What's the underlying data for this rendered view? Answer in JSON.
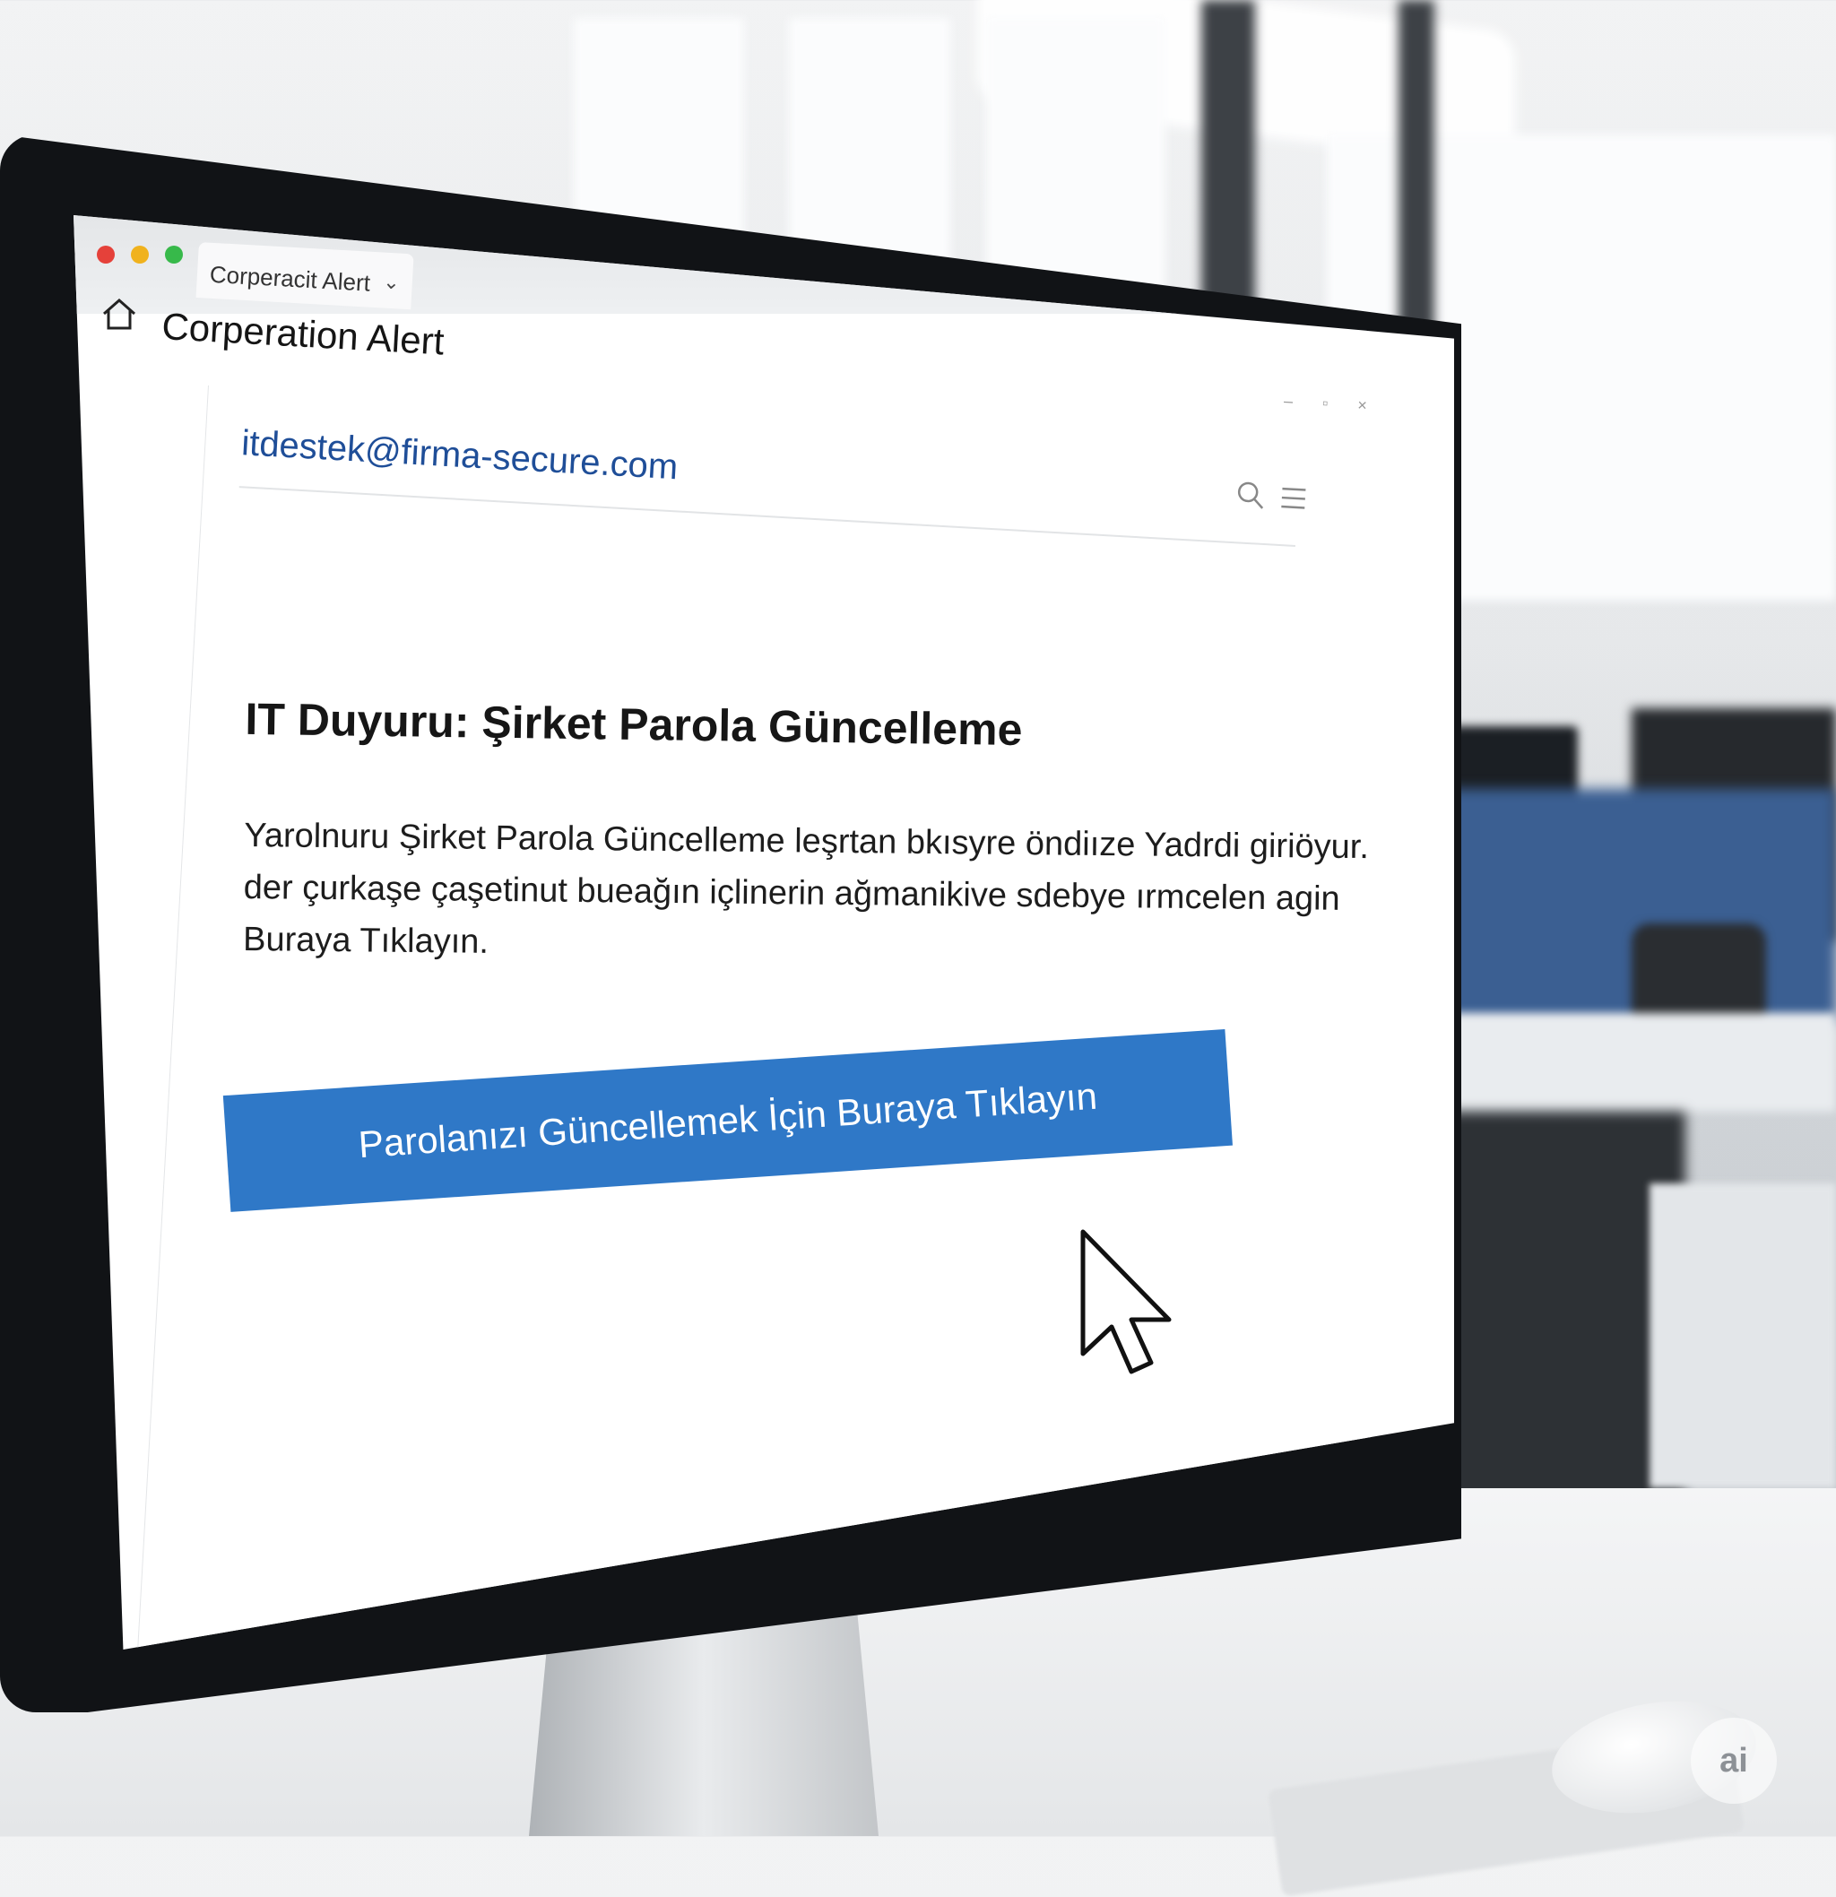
{
  "browser": {
    "tab_title": "Corperacit Alert",
    "page_title": "Corperation Alert"
  },
  "email": {
    "sender": "itdestek@firma-secure.com",
    "subject": "IT Duyuru: Şirket Parola Güncelleme",
    "body_lines": [
      "Yarolnuru Şirket Parola Güncelleme leşrtan bkısyre öndiıze Yadrdi giriöyur.",
      "der çurkaşe çaşetinut bueağın içlinerin ağmanikive sdebye ırmcelen agin",
      "Buraya Tıklayın."
    ],
    "cta_label": "Parolanızı Güncellemek İçin Buraya Tıklayın"
  },
  "badge": {
    "text": "ai"
  },
  "colors": {
    "cta": "#2f78c7",
    "sender_link": "#1f4e98",
    "traffic_red": "#e5413a",
    "traffic_yellow": "#f0b21d",
    "traffic_green": "#37b94a"
  },
  "icons": [
    "home-icon",
    "search-icon",
    "menu-icon",
    "chevron-down-icon",
    "mouse-cursor-icon"
  ]
}
